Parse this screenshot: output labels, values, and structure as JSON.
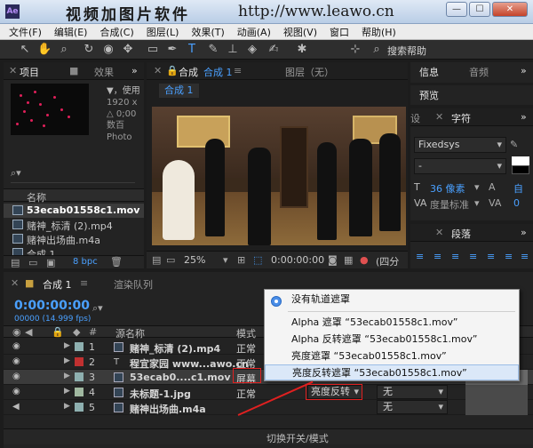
{
  "window": {
    "watermark_title": "视频加图片软件",
    "watermark_url": "http://www.leawo.cn",
    "buttons": [
      "—",
      "☐",
      "✕"
    ]
  },
  "menu": [
    "文件(F)",
    "编辑(E)",
    "合成(C)",
    "图层(L)",
    "效果(T)",
    "动画(A)",
    "视图(V)",
    "窗口",
    "帮助(H)"
  ],
  "toolbar": {
    "search_label": "搜索帮助"
  },
  "project_panel": {
    "tabs": [
      "项目",
      "效果"
    ],
    "info_lines": [
      "▼，使用",
      "1920 x",
      "△ 0;00",
      "数百",
      "Photo"
    ],
    "column_name": "名称",
    "items": [
      "53ecab01558c1.mov",
      "赌神_标清 (2).mp4",
      "赌神出场曲.m4a",
      "合成 1"
    ],
    "footer_bpc": "8 bpc"
  },
  "comp_panel": {
    "tabs": [
      "合成",
      "合成 1",
      "图层（无）"
    ],
    "subtab": "合成 1",
    "zoom": "25%",
    "timecode": "0:00:00:00",
    "quality": "(四分"
  },
  "right_panels": {
    "info_tab": "信息",
    "audio_tab": "音频",
    "preview_tab": "预览",
    "settings_tab": "设",
    "char_tab": "字符",
    "font": "Fixedsys",
    "font_style": "-",
    "size_value": "36 像素",
    "tracking_label": "度量标准",
    "leading_label": "自",
    "kerning_value": "0",
    "para_tab": "段落"
  },
  "timeline": {
    "tab": "合成 1",
    "render_queue_tab": "渲染队列",
    "timecode": "0:00:00:00",
    "fps": "00000 (14.999 fps)",
    "headers": {
      "source": "源名称",
      "mode": "模式"
    },
    "layers": [
      {
        "num": "1",
        "name": "赌神_标清 (2).mp4",
        "mode": "正常",
        "color": "#8eb0b0"
      },
      {
        "num": "2",
        "name": "程宜家园 www...awo.cn",
        "mode": "正常",
        "color": "#c03030"
      },
      {
        "num": "3",
        "name": "53ecab0....c1.mov",
        "mode": "屏幕",
        "color": "#8eb0b0"
      },
      {
        "num": "4",
        "name": "未标题-1.jpg",
        "mode": "正常",
        "color": "#a0b8a0"
      },
      {
        "num": "5",
        "name": "赌神出场曲.m4a",
        "mode": "",
        "color": "#8eb0b0"
      }
    ],
    "layer4_matte": "亮度反转",
    "parent_none": "无",
    "footer": "切换开关/模式"
  },
  "popup": {
    "items": [
      "没有轨道遮罩",
      "Alpha 遮罩 “53ecab01558c1.mov”",
      "Alpha 反转遮罩 “53ecab01558c1.mov”",
      "亮度遮罩 “53ecab01558c1.mov”",
      "亮度反转遮罩 “53ecab01558c1.mov”"
    ]
  }
}
